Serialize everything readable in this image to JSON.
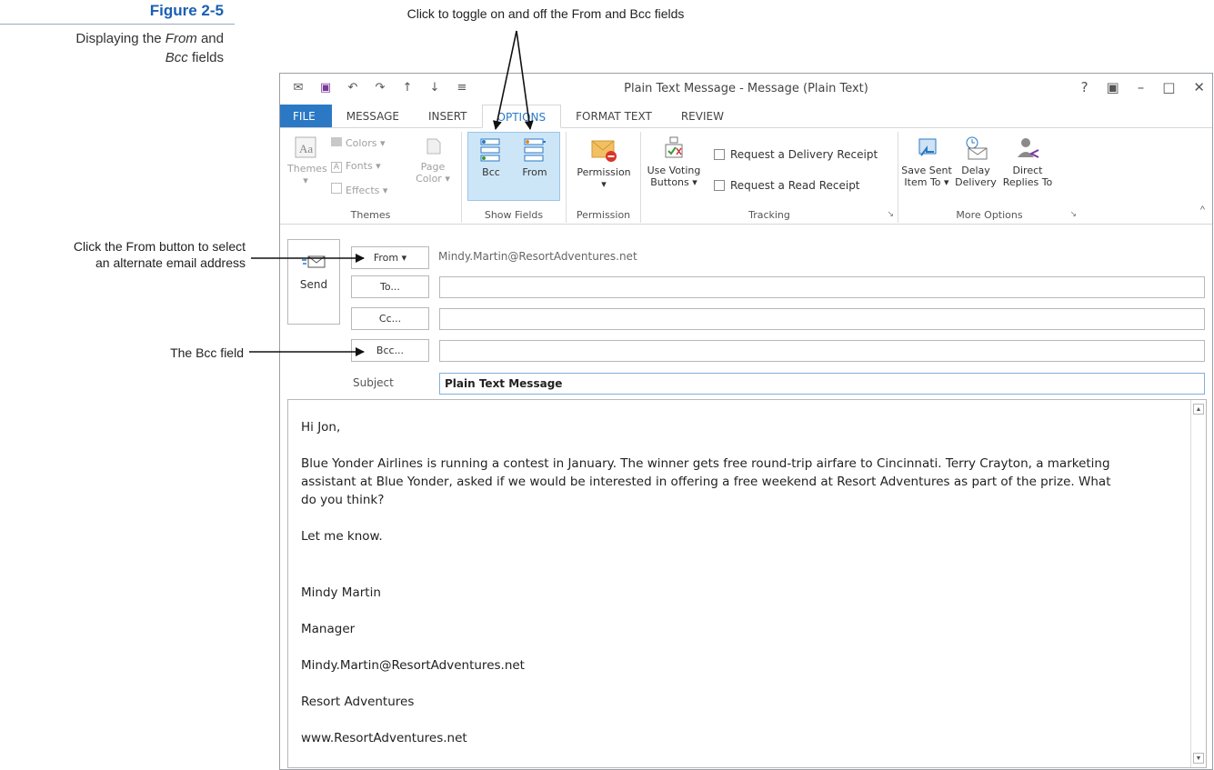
{
  "figure": {
    "number": "Figure 2-5",
    "desc_prefix": "Displaying the ",
    "desc_from": "From",
    "desc_and": " and",
    "desc_bcc": "Bcc",
    "desc_suffix": " fields"
  },
  "callouts": {
    "top": "Click to toggle on and off the From and Bcc fields",
    "from_line1": "Click the From button to select",
    "from_line2": "an alternate email address",
    "bcc": "The Bcc field"
  },
  "window": {
    "title": "Plain Text Message - Message (Plain Text)",
    "help": "?",
    "controls": [
      "?",
      "▣",
      "–",
      "□",
      "✕"
    ]
  },
  "tabs": [
    "FILE",
    "MESSAGE",
    "INSERT",
    "OPTIONS",
    "FORMAT TEXT",
    "REVIEW"
  ],
  "active_tab": "OPTIONS",
  "ribbon": {
    "themes": {
      "themes_btn": "Themes",
      "colors": "Colors",
      "fonts": "Fonts",
      "effects": "Effects",
      "page_color_1": "Page",
      "page_color_2": "Color",
      "label": "Themes"
    },
    "show_fields": {
      "bcc": "Bcc",
      "from": "From",
      "label": "Show Fields"
    },
    "permission": {
      "btn": "Permission",
      "label": "Permission"
    },
    "tracking": {
      "voting_1": "Use Voting",
      "voting_2": "Buttons",
      "delivery_receipt": "Request a Delivery Receipt",
      "read_receipt": "Request a Read Receipt",
      "label": "Tracking"
    },
    "more_options": {
      "save_sent_1": "Save Sent",
      "save_sent_2": "Item To",
      "delay_1": "Delay",
      "delay_2": "Delivery",
      "direct_1": "Direct",
      "direct_2": "Replies To",
      "label": "More Options"
    }
  },
  "header": {
    "send": "Send",
    "from_btn": "From ▾",
    "from_address": "Mindy.Martin@ResortAdventures.net",
    "to_btn": "To...",
    "cc_btn": "Cc...",
    "bcc_btn": "Bcc...",
    "to_value": "",
    "cc_value": "",
    "bcc_value": "",
    "subject_label": "Subject",
    "subject_value": "Plain Text Message"
  },
  "body": {
    "greeting": "Hi Jon,",
    "para1_line1": "Blue Yonder Airlines is running a contest in January. The winner gets free round-trip airfare to Cincinnati. Terry Crayton, a marketing",
    "para1_line2": "assistant at Blue Yonder, asked if we would be interested in offering a free weekend at Resort Adventures as part of the prize. What",
    "para1_line3": "do you think?",
    "para2": "Let me know.",
    "sig_name": "Mindy Martin",
    "sig_title": "Manager",
    "sig_email": "Mindy.Martin@ResortAdventures.net",
    "sig_company": "Resort Adventures",
    "sig_web": "www.ResortAdventures.net"
  }
}
